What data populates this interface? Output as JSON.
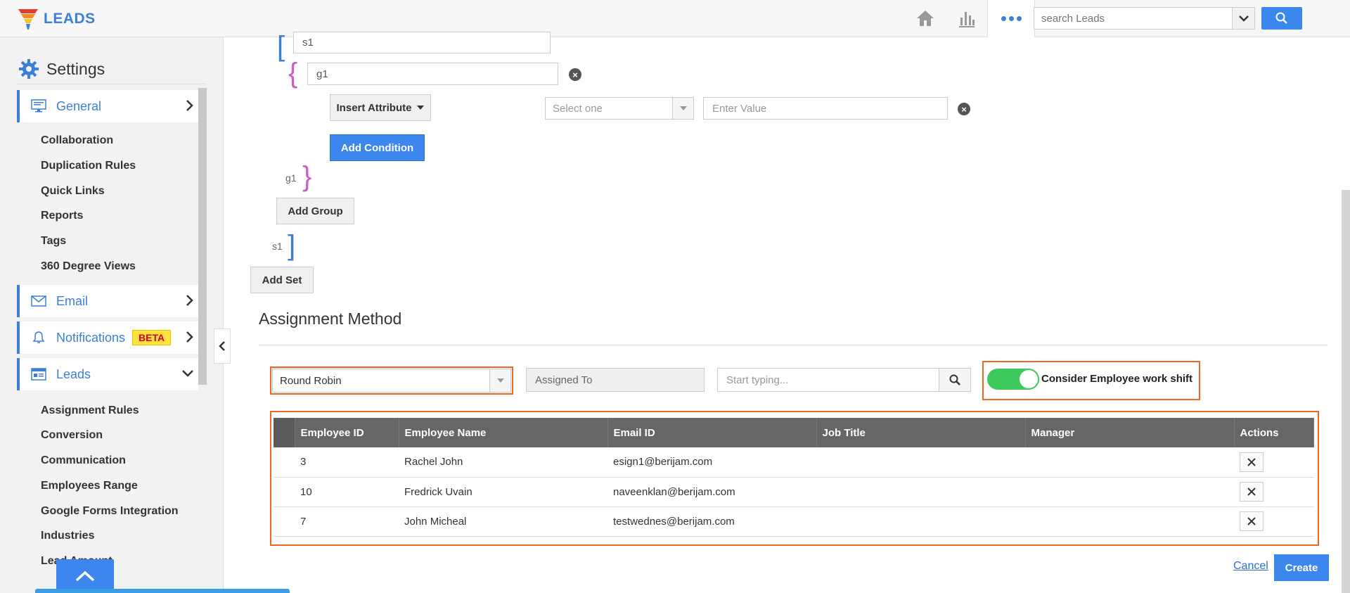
{
  "app": {
    "title": "LEADS"
  },
  "header": {
    "search_placeholder": "search Leads",
    "home_icon": "home-icon",
    "reports_icon": "bar-chart-icon",
    "more_icon": "more-dots-icon"
  },
  "sidebar": {
    "title": "Settings",
    "sections": {
      "general": {
        "label": "General",
        "icon": "monitor-icon"
      },
      "email": {
        "label": "Email",
        "icon": "envelope-icon"
      },
      "notifications": {
        "label": "Notifications",
        "badge": "BETA",
        "icon": "bell-icon"
      },
      "leads": {
        "label": "Leads",
        "icon": "lead-card-icon"
      }
    },
    "general_items": [
      "Collaboration",
      "Duplication Rules",
      "Quick Links",
      "Reports",
      "Tags",
      "360 Degree Views"
    ],
    "leads_items": [
      "Assignment Rules",
      "Conversion",
      "Communication",
      "Employees Range",
      "Google Forms Integration",
      "Industries",
      "Lead Amount"
    ]
  },
  "rules": {
    "set_name": "s1",
    "group_name": "g1",
    "insert_attribute_label": "Insert Attribute",
    "select_placeholder": "Select one",
    "value_placeholder": "Enter Value",
    "add_condition_label": "Add Condition",
    "group_end_label": "g1",
    "add_group_label": "Add Group",
    "set_end_label": "s1",
    "add_set_label": "Add Set"
  },
  "assignment": {
    "title": "Assignment Method",
    "method": "Round Robin",
    "assigned_to_placeholder": "Assigned To",
    "search_placeholder": "Start typing...",
    "toggle_label": "Consider Employee work shift",
    "toggle_on": true,
    "columns": [
      "Employee ID",
      "Employee Name",
      "Email ID",
      "Job Title",
      "Manager",
      "Actions"
    ],
    "rows": [
      {
        "id": "3",
        "name": "Rachel John",
        "email": "esign1@berijam.com",
        "job": "",
        "manager": ""
      },
      {
        "id": "10",
        "name": "Fredrick Uvain",
        "email": "naveenklan@berijam.com",
        "job": "",
        "manager": ""
      },
      {
        "id": "7",
        "name": "John Micheal",
        "email": "testwednes@berijam.com",
        "job": "",
        "manager": ""
      }
    ]
  },
  "footer": {
    "cancel_label": "Cancel",
    "create_label": "Create"
  },
  "colors": {
    "brand": "#3d7fd6",
    "primary_button": "#3c87ee",
    "highlight": "#f26522",
    "toggle_on": "#3ec95c",
    "table_header": "#666666"
  }
}
